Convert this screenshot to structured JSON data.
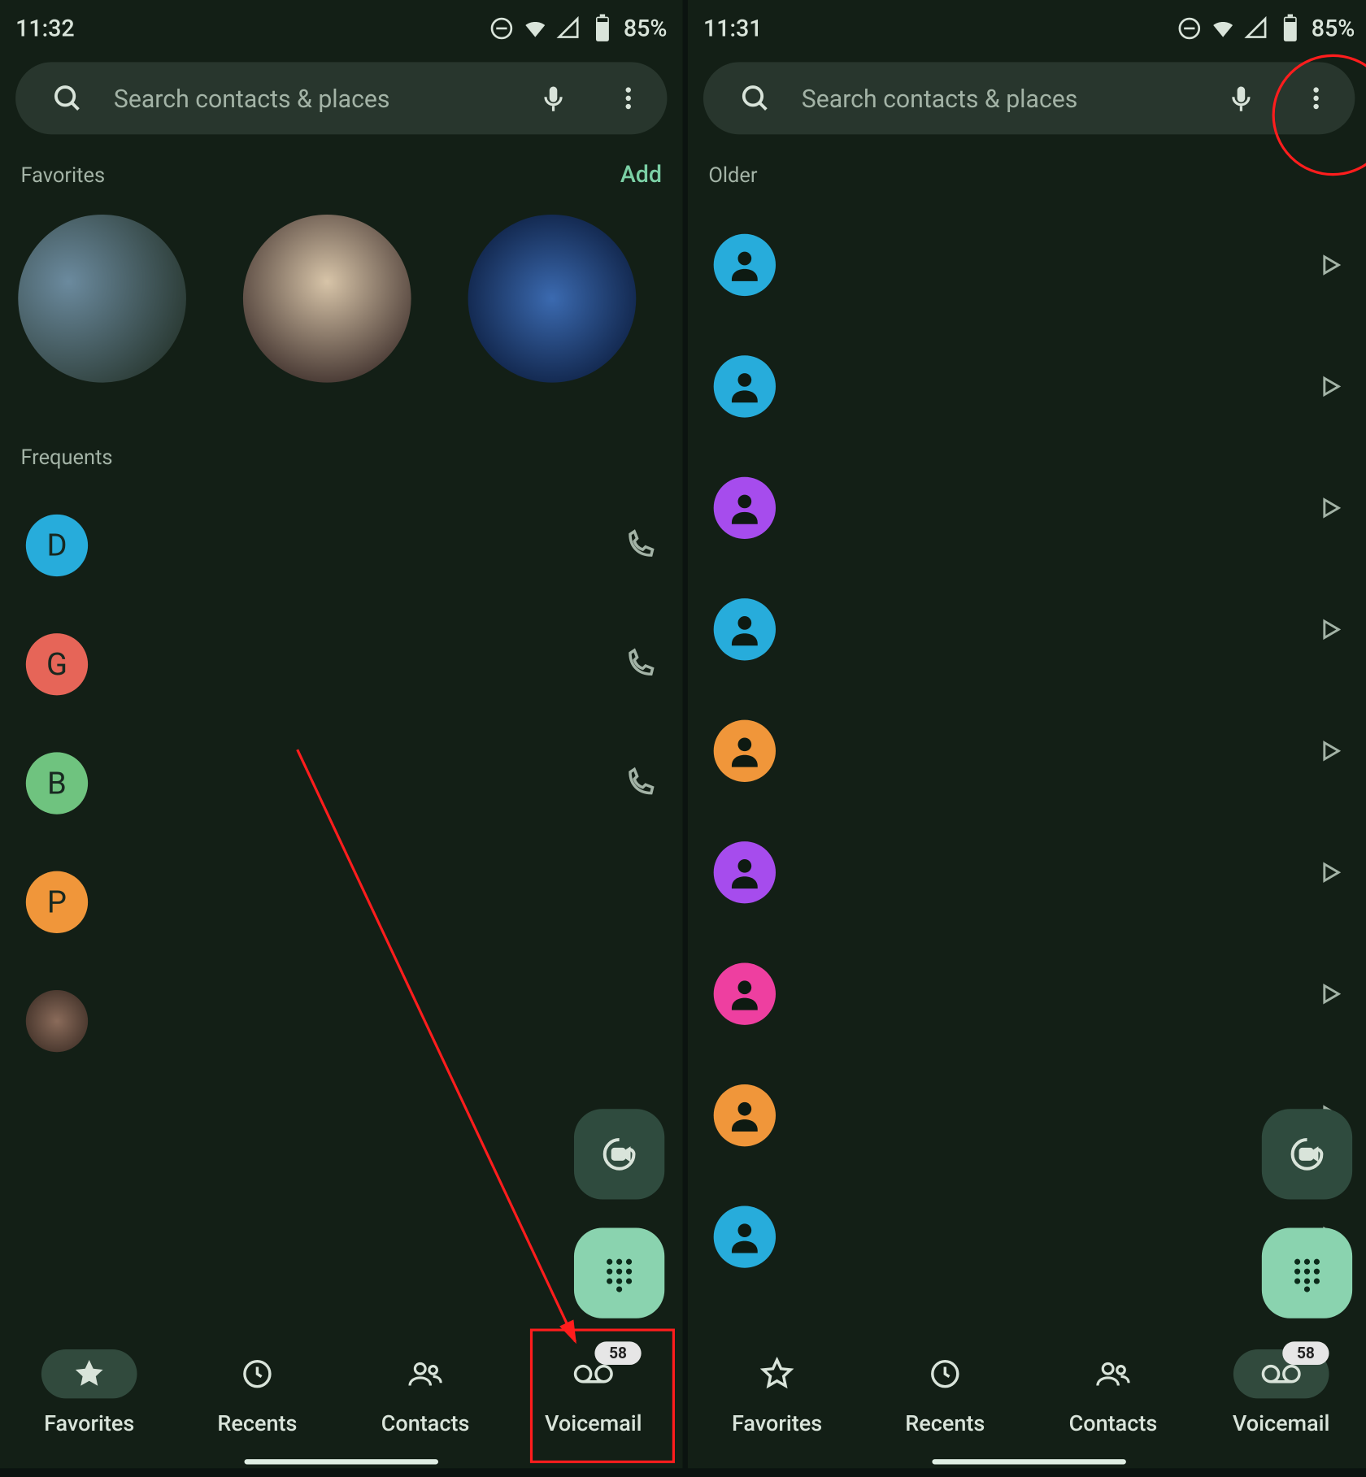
{
  "left": {
    "status": {
      "time": "11:32",
      "battery": "85%"
    },
    "search_placeholder": "Search contacts & places",
    "favorites_title": "Favorites",
    "favorites_add": "Add",
    "frequents_title": "Frequents",
    "frequents": [
      {
        "letter": "D",
        "color": "#27acdb"
      },
      {
        "letter": "G",
        "color": "#e66558"
      },
      {
        "letter": "B",
        "color": "#6fc37f"
      },
      {
        "letter": "P",
        "color": "#f0963a"
      },
      {
        "photo": true
      }
    ],
    "nav": {
      "favorites": "Favorites",
      "recents": "Recents",
      "contacts": "Contacts",
      "voicemail": "Voicemail",
      "voicemail_badge": "58",
      "active": "favorites"
    }
  },
  "right": {
    "status": {
      "time": "11:31",
      "battery": "85%"
    },
    "search_placeholder": "Search contacts & places",
    "older_title": "Older",
    "voicemails": [
      {
        "color": "#27acdb"
      },
      {
        "color": "#27acdb"
      },
      {
        "color": "#a64ced"
      },
      {
        "color": "#27acdb"
      },
      {
        "color": "#f0963a"
      },
      {
        "color": "#a64ced"
      },
      {
        "color": "#ee3fa0"
      },
      {
        "color": "#f0963a"
      },
      {
        "color": "#27acdb"
      }
    ],
    "nav": {
      "favorites": "Favorites",
      "recents": "Recents",
      "contacts": "Contacts",
      "voicemail": "Voicemail",
      "voicemail_badge": "58",
      "active": "voicemail"
    }
  }
}
